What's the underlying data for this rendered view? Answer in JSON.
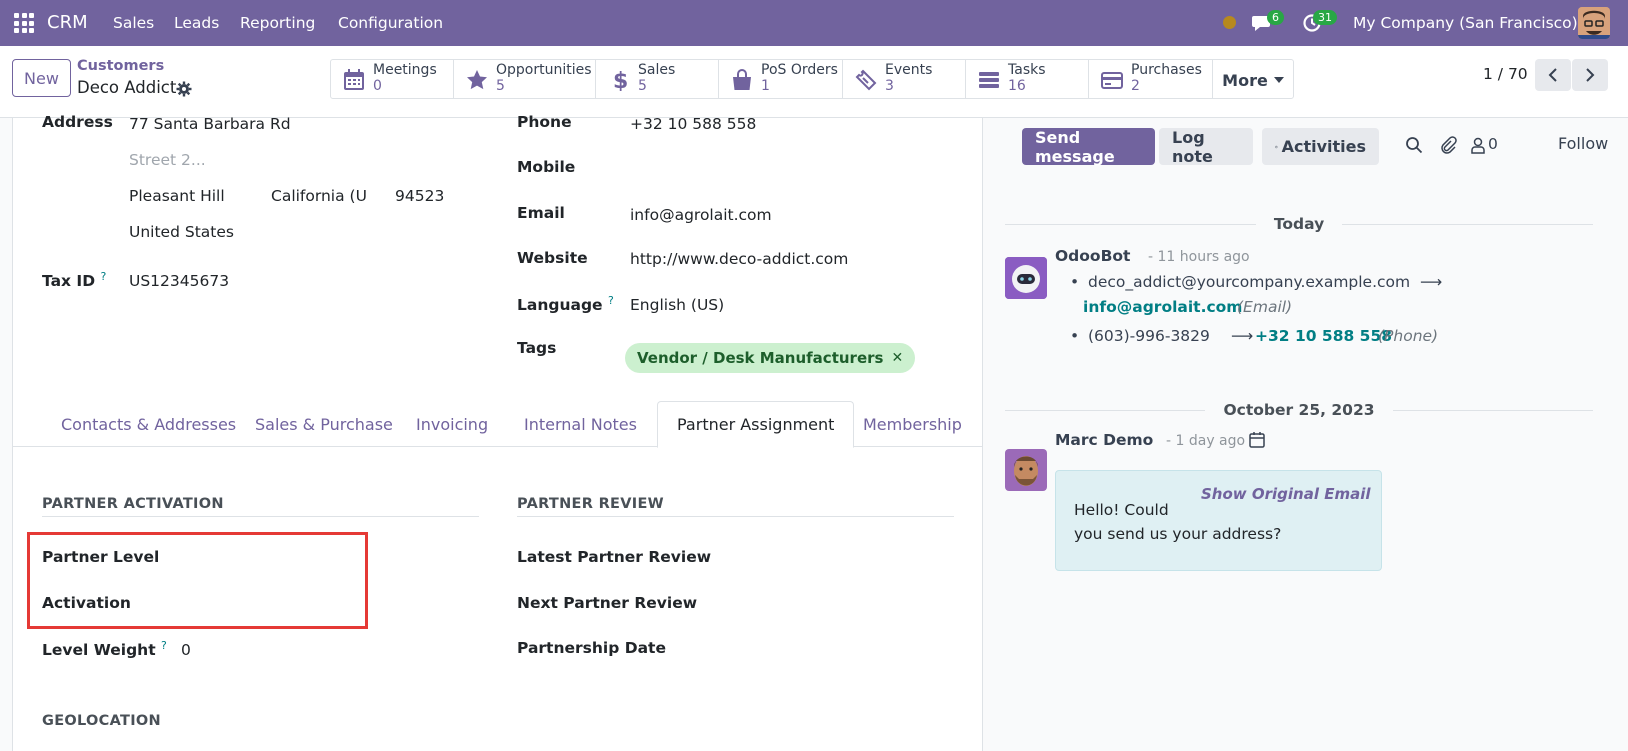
{
  "nav": {
    "app": "CRM",
    "menus": [
      "Sales",
      "Leads",
      "Reporting",
      "Configuration"
    ],
    "chat_count": "6",
    "activity_count": "31",
    "company": "My Company (San Francisco)"
  },
  "control": {
    "new_label": "New",
    "breadcrumb_parent": "Customers",
    "breadcrumb_current": "Deco Addict",
    "stats": [
      {
        "label": "Meetings",
        "value": "0",
        "icon": "calendar-icon"
      },
      {
        "label": "Opportunities",
        "value": "5",
        "icon": "star-icon"
      },
      {
        "label": "Sales",
        "value": "5",
        "icon": "dollar-icon"
      },
      {
        "label": "PoS Orders",
        "value": "1",
        "icon": "shopping-bag-icon"
      },
      {
        "label": "Events",
        "value": "3",
        "icon": "ticket-icon"
      },
      {
        "label": "Tasks",
        "value": "16",
        "icon": "tasks-icon"
      },
      {
        "label": "Purchases",
        "value": "2",
        "icon": "credit-card-icon"
      }
    ],
    "more_label": "More",
    "pager": "1 / 70"
  },
  "form": {
    "address_label": "Address",
    "street": "77 Santa Barbara Rd",
    "street2_placeholder": "Street 2...",
    "city": "Pleasant Hill",
    "state": "California (US",
    "zip": "94523",
    "country": "United States",
    "tax_label": "Tax ID",
    "tax_value": "US12345673",
    "phone_label": "Phone",
    "phone_value": "+32 10 588 558",
    "mobile_label": "Mobile",
    "email_label": "Email",
    "email_value": "info@agrolait.com",
    "website_label": "Website",
    "website_value": "http://www.deco-addict.com",
    "language_label": "Language",
    "language_value": "English (US)",
    "tags_label": "Tags",
    "tag_value": "Vendor / Desk Manufacturers",
    "tabs": [
      "Contacts & Addresses",
      "Sales & Purchase",
      "Invoicing",
      "Internal Notes",
      "Partner Assignment",
      "Membership"
    ],
    "partner_activation_title": "PARTNER ACTIVATION",
    "partner_level_label": "Partner Level",
    "activation_label": "Activation",
    "level_weight_label": "Level Weight",
    "level_weight_value": "0",
    "partner_review_title": "PARTNER REVIEW",
    "latest_review_label": "Latest Partner Review",
    "next_review_label": "Next Partner Review",
    "partnership_date_label": "Partnership Date",
    "geolocation_title": "GEOLOCATION"
  },
  "chatter": {
    "send_message": "Send message",
    "log_note": "Log note",
    "activities": "Activities",
    "followers_count": "0",
    "follow": "Follow",
    "date1": "Today",
    "msg1_author": "OdooBot",
    "msg1_time": "- 11 hours ago",
    "msg1_old_email": "deco_addict@yourcompany.example.com",
    "msg1_new_email": "info@agrolait.com",
    "msg1_email_field": "(Email)",
    "msg1_old_phone": "(603)-996-3829",
    "msg1_new_phone": "+32 10 588 558",
    "msg1_phone_field": "(Phone)",
    "date2": "October 25, 2023",
    "msg2_author": "Marc Demo",
    "msg2_time": "- 1 day ago",
    "show_original": "Show Original Email",
    "msg2_line1": "Hello! Could",
    "msg2_line2": "you send us your address?"
  },
  "colors": {
    "brand": "#71639e",
    "link": "#017e84",
    "highlight": "#e53935",
    "tag_bg": "#ccf0cf"
  }
}
